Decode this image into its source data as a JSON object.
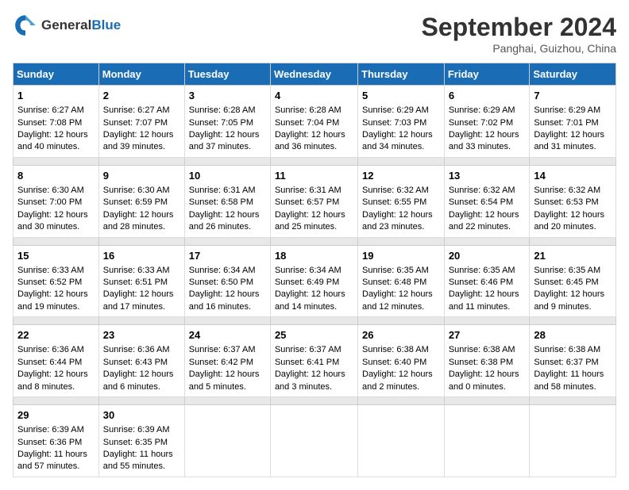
{
  "header": {
    "logo_line1": "General",
    "logo_line2": "Blue",
    "month_title": "September 2024",
    "subtitle": "Panghai, Guizhou, China"
  },
  "days_of_week": [
    "Sunday",
    "Monday",
    "Tuesday",
    "Wednesday",
    "Thursday",
    "Friday",
    "Saturday"
  ],
  "weeks": [
    [
      {
        "day": "1",
        "sunrise": "6:27 AM",
        "sunset": "7:08 PM",
        "daylight": "12 hours and 40 minutes."
      },
      {
        "day": "2",
        "sunrise": "6:27 AM",
        "sunset": "7:07 PM",
        "daylight": "12 hours and 39 minutes."
      },
      {
        "day": "3",
        "sunrise": "6:28 AM",
        "sunset": "7:05 PM",
        "daylight": "12 hours and 37 minutes."
      },
      {
        "day": "4",
        "sunrise": "6:28 AM",
        "sunset": "7:04 PM",
        "daylight": "12 hours and 36 minutes."
      },
      {
        "day": "5",
        "sunrise": "6:29 AM",
        "sunset": "7:03 PM",
        "daylight": "12 hours and 34 minutes."
      },
      {
        "day": "6",
        "sunrise": "6:29 AM",
        "sunset": "7:02 PM",
        "daylight": "12 hours and 33 minutes."
      },
      {
        "day": "7",
        "sunrise": "6:29 AM",
        "sunset": "7:01 PM",
        "daylight": "12 hours and 31 minutes."
      }
    ],
    [
      {
        "day": "8",
        "sunrise": "6:30 AM",
        "sunset": "7:00 PM",
        "daylight": "12 hours and 30 minutes."
      },
      {
        "day": "9",
        "sunrise": "6:30 AM",
        "sunset": "6:59 PM",
        "daylight": "12 hours and 28 minutes."
      },
      {
        "day": "10",
        "sunrise": "6:31 AM",
        "sunset": "6:58 PM",
        "daylight": "12 hours and 26 minutes."
      },
      {
        "day": "11",
        "sunrise": "6:31 AM",
        "sunset": "6:57 PM",
        "daylight": "12 hours and 25 minutes."
      },
      {
        "day": "12",
        "sunrise": "6:32 AM",
        "sunset": "6:55 PM",
        "daylight": "12 hours and 23 minutes."
      },
      {
        "day": "13",
        "sunrise": "6:32 AM",
        "sunset": "6:54 PM",
        "daylight": "12 hours and 22 minutes."
      },
      {
        "day": "14",
        "sunrise": "6:32 AM",
        "sunset": "6:53 PM",
        "daylight": "12 hours and 20 minutes."
      }
    ],
    [
      {
        "day": "15",
        "sunrise": "6:33 AM",
        "sunset": "6:52 PM",
        "daylight": "12 hours and 19 minutes."
      },
      {
        "day": "16",
        "sunrise": "6:33 AM",
        "sunset": "6:51 PM",
        "daylight": "12 hours and 17 minutes."
      },
      {
        "day": "17",
        "sunrise": "6:34 AM",
        "sunset": "6:50 PM",
        "daylight": "12 hours and 16 minutes."
      },
      {
        "day": "18",
        "sunrise": "6:34 AM",
        "sunset": "6:49 PM",
        "daylight": "12 hours and 14 minutes."
      },
      {
        "day": "19",
        "sunrise": "6:35 AM",
        "sunset": "6:48 PM",
        "daylight": "12 hours and 12 minutes."
      },
      {
        "day": "20",
        "sunrise": "6:35 AM",
        "sunset": "6:46 PM",
        "daylight": "12 hours and 11 minutes."
      },
      {
        "day": "21",
        "sunrise": "6:35 AM",
        "sunset": "6:45 PM",
        "daylight": "12 hours and 9 minutes."
      }
    ],
    [
      {
        "day": "22",
        "sunrise": "6:36 AM",
        "sunset": "6:44 PM",
        "daylight": "12 hours and 8 minutes."
      },
      {
        "day": "23",
        "sunrise": "6:36 AM",
        "sunset": "6:43 PM",
        "daylight": "12 hours and 6 minutes."
      },
      {
        "day": "24",
        "sunrise": "6:37 AM",
        "sunset": "6:42 PM",
        "daylight": "12 hours and 5 minutes."
      },
      {
        "day": "25",
        "sunrise": "6:37 AM",
        "sunset": "6:41 PM",
        "daylight": "12 hours and 3 minutes."
      },
      {
        "day": "26",
        "sunrise": "6:38 AM",
        "sunset": "6:40 PM",
        "daylight": "12 hours and 2 minutes."
      },
      {
        "day": "27",
        "sunrise": "6:38 AM",
        "sunset": "6:38 PM",
        "daylight": "12 hours and 0 minutes."
      },
      {
        "day": "28",
        "sunrise": "6:38 AM",
        "sunset": "6:37 PM",
        "daylight": "11 hours and 58 minutes."
      }
    ],
    [
      {
        "day": "29",
        "sunrise": "6:39 AM",
        "sunset": "6:36 PM",
        "daylight": "11 hours and 57 minutes."
      },
      {
        "day": "30",
        "sunrise": "6:39 AM",
        "sunset": "6:35 PM",
        "daylight": "11 hours and 55 minutes."
      },
      null,
      null,
      null,
      null,
      null
    ]
  ]
}
